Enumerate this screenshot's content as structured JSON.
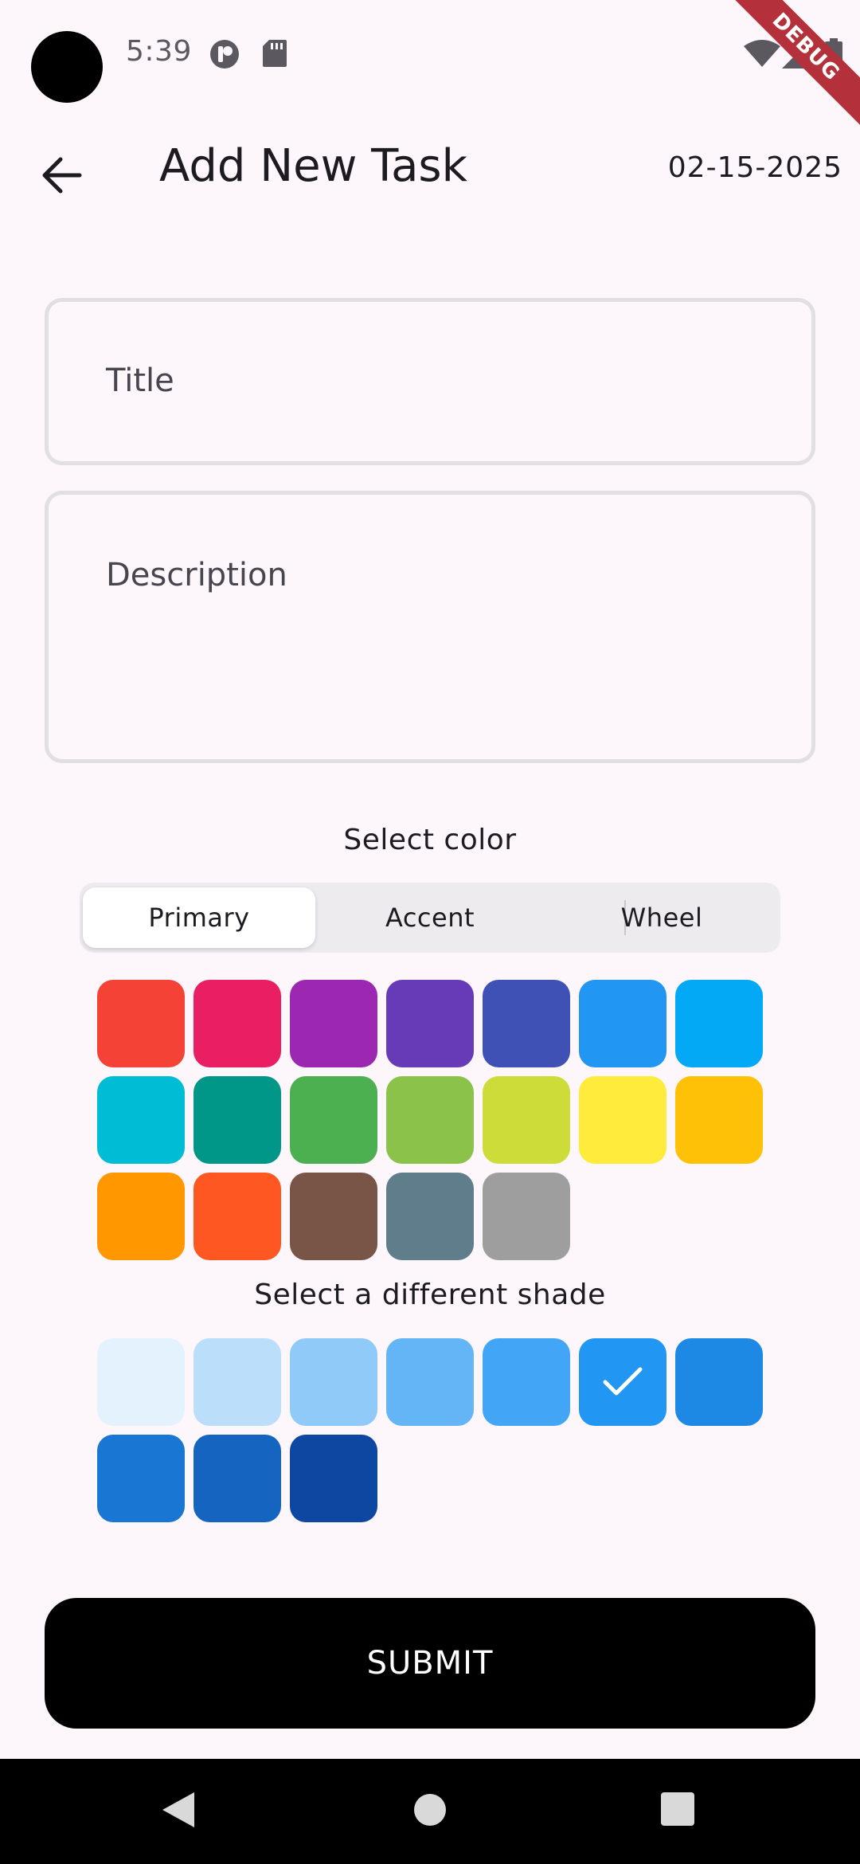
{
  "status_bar": {
    "time": "5:39",
    "icons": [
      "notification-app-icon",
      "sd-card-icon",
      "wifi-icon",
      "cell-signal-icon",
      "battery-icon"
    ],
    "debug_label": "DEBUG"
  },
  "app_bar": {
    "title": "Add New Task",
    "date": "02-15-2025",
    "back_icon": "arrow-left-icon"
  },
  "form": {
    "title_label": "Title",
    "description_label": "Description"
  },
  "color_picker": {
    "heading": "Select color",
    "tabs": [
      {
        "label": "Primary",
        "active": true
      },
      {
        "label": "Accent",
        "active": false
      },
      {
        "label": "Wheel",
        "active": false
      }
    ],
    "primary_colors": [
      "#f44336",
      "#e91e63",
      "#9c27b0",
      "#673ab7",
      "#3f51b5",
      "#2196f3",
      "#03a9f4",
      "#00bcd4",
      "#009688",
      "#4caf50",
      "#8bc34a",
      "#cddc39",
      "#ffeb3b",
      "#ffc107",
      "#ff9800",
      "#ff5722",
      "#795548",
      "#607d8b",
      "#9e9e9e"
    ],
    "shade_heading": "Select a different shade",
    "shades": [
      "#e3f2fd",
      "#bbdefb",
      "#90caf9",
      "#64b5f6",
      "#42a5f5",
      "#2196f3",
      "#1e88e5",
      "#1976d2",
      "#1565c0",
      "#0d47a1"
    ],
    "selected_shade_index": 5,
    "selected_icon": "check-icon"
  },
  "submit": {
    "label": "SUBMIT"
  },
  "nav_bar": {
    "icons": [
      "back-triangle-icon",
      "home-circle-icon",
      "recents-square-icon"
    ]
  }
}
